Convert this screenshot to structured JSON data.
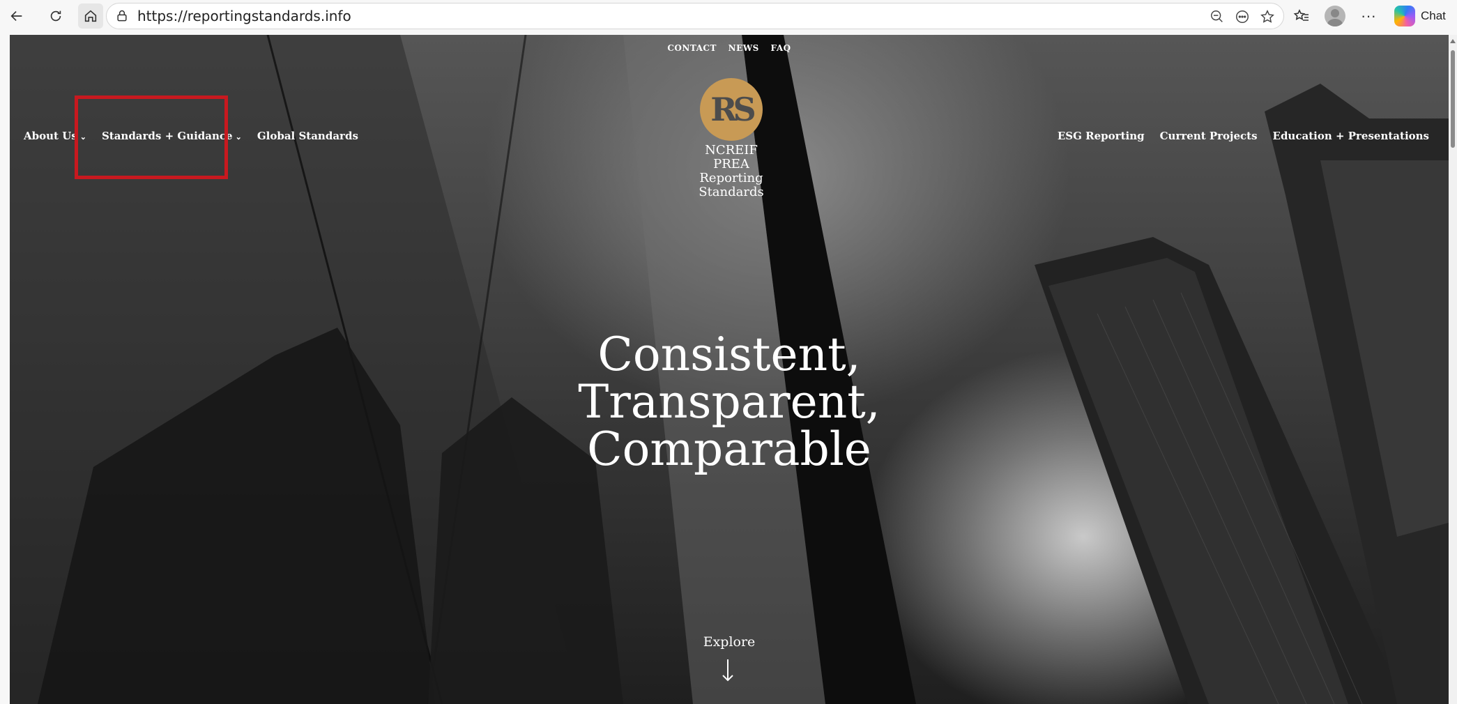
{
  "browser": {
    "url": "https://reportingstandards.info",
    "chat_label": "Chat"
  },
  "site": {
    "top_links": [
      "CONTACT",
      "NEWS",
      "FAQ"
    ],
    "nav_left": [
      "About Us",
      "Standards + Guidance",
      "Global Standards"
    ],
    "nav_right": [
      "ESG Reporting",
      "Current Projects",
      "Education + Presentations"
    ],
    "logo_initials": "RS",
    "logo_lines": [
      "NCREIF",
      "PREA",
      "Reporting",
      "Standards"
    ],
    "headline_lines": [
      "Consistent,",
      "Transparent,",
      "Comparable"
    ],
    "explore_label": "Explore",
    "highlight_color": "#c8191f",
    "logo_color": "#c89a55"
  }
}
